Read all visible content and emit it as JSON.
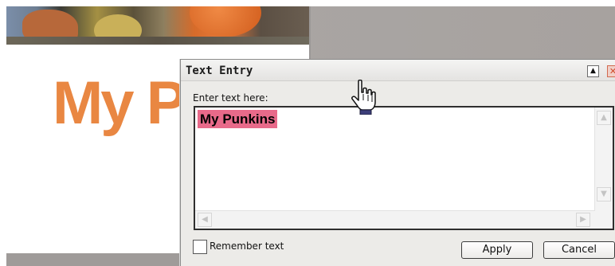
{
  "canvas": {
    "title": "My Pu"
  },
  "dialog": {
    "title": "Text Entry",
    "prompt": "Enter text here:",
    "text_value": "My Punkins",
    "remember_label": "Remember text",
    "remember_checked": false,
    "apply_label": "Apply",
    "cancel_label": "Cancel",
    "minimize_glyph": "▲",
    "close_glyph": "✕"
  },
  "scrollbar": {
    "up_glyph": "▲",
    "down_glyph": "▼",
    "left_glyph": "◀",
    "right_glyph": "▶"
  },
  "colors": {
    "title_orange": "#e98742",
    "text_highlight": "#e86a8a",
    "close_red": "#d2492a"
  },
  "icons": {
    "cursor": "hand-pointer-icon",
    "minimize": "minimize-icon",
    "close": "close-icon",
    "checkbox": "checkbox-icon"
  }
}
